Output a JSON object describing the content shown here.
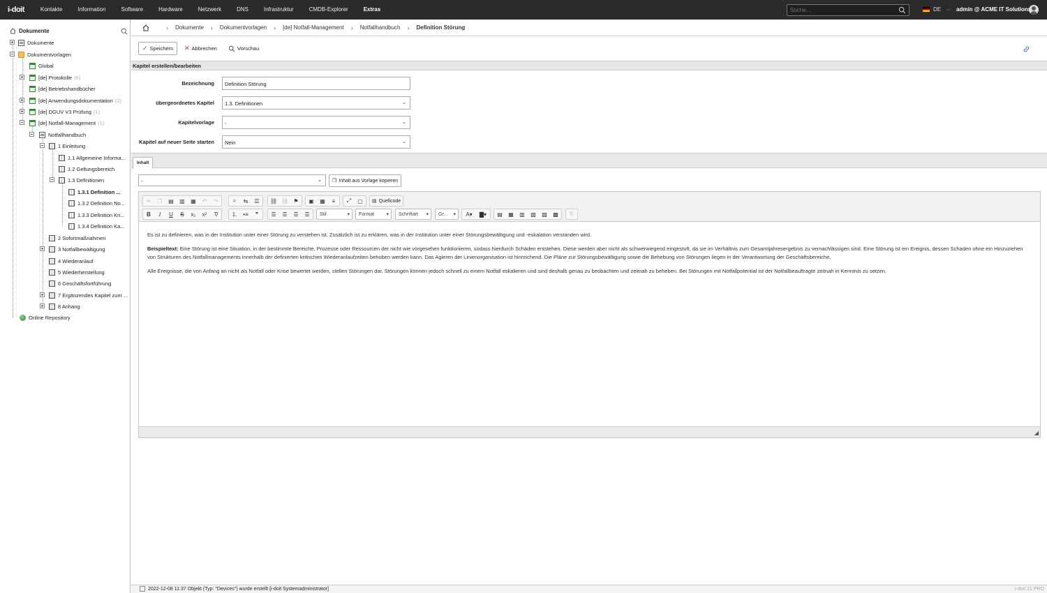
{
  "topbar": {
    "logo": "i-doit",
    "menu": [
      "Kontakte",
      "Information",
      "Software",
      "Hardware",
      "Netzwerk",
      "DNS",
      "Infrastruktur",
      "CMDB-Explorer",
      "Extras"
    ],
    "search_placeholder": "Suche...",
    "language": "DE",
    "user": "admin @ ACME IT Solutions"
  },
  "sidebar": {
    "title": "Dokumente",
    "tree": [
      {
        "label": "Dokumente",
        "icon": "document-icon"
      },
      {
        "label": "Dokumentvorlagen",
        "icon": "folder-icon"
      },
      {
        "label": "Global",
        "icon": "template-icon"
      },
      {
        "label": "[de] Protokolle",
        "count": "(6)",
        "icon": "template-icon"
      },
      {
        "label": "[de] Betriebshandbücher",
        "icon": "template-icon"
      },
      {
        "label": "[de] Anwendungsdokumentation",
        "count": "(2)",
        "icon": "template-icon"
      },
      {
        "label": "[de] DGUV V3 Prüfung",
        "count": "(1)",
        "icon": "template-icon"
      },
      {
        "label": "[de] Notfall-Management",
        "count": "(1)",
        "icon": "template-icon"
      },
      {
        "label": "Notfallhandbuch",
        "icon": "document-icon"
      },
      {
        "label": "1 Einleitung",
        "icon": "book-icon"
      },
      {
        "label": "1.1 Allgemeine Informa...",
        "icon": "book-icon"
      },
      {
        "label": "1.2 Geltungsbereich",
        "icon": "book-icon"
      },
      {
        "label": "1.3 Definitionen",
        "icon": "book-icon"
      },
      {
        "label": "1.3.1 Definition ...",
        "icon": "book-icon"
      },
      {
        "label": "1.3.2 Definition No...",
        "icon": "book-icon"
      },
      {
        "label": "1.3.3 Definition Kri...",
        "icon": "book-icon"
      },
      {
        "label": "1.3.4 Definition Ka...",
        "icon": "book-icon"
      },
      {
        "label": "2 Sofortmaßnahmen",
        "icon": "book-icon"
      },
      {
        "label": "3 Notfallbewältigung",
        "icon": "book-icon"
      },
      {
        "label": "4 Wiederanlauf",
        "icon": "book-icon"
      },
      {
        "label": "5 Wiederherstellung",
        "icon": "book-icon"
      },
      {
        "label": "6 Geschäftsfortführung",
        "icon": "book-icon"
      },
      {
        "label": "7 Ergänzendes Kapitel zum ...",
        "icon": "book-icon"
      },
      {
        "label": "8 Anhang",
        "icon": "book-icon"
      },
      {
        "label": "Online Repository",
        "icon": "globe-icon"
      }
    ]
  },
  "breadcrumb": [
    "Dokumente",
    "Dokumentvorlagen",
    "[de] Notfall-Management",
    "Notfallhandbuch",
    "Definition Störung"
  ],
  "toolbar": {
    "save": "Speichern",
    "cancel": "Abbrechen",
    "preview": "Vorschau"
  },
  "section_title": "Kapitel erstellen/bearbeiten",
  "form": {
    "name_label": "Bezeichnung",
    "name_value": "Definition Störung",
    "parent_label": "übergeordnetes Kapitel",
    "parent_value": "1.3. Definitionen",
    "template_label": "Kapitelvorlage",
    "template_value": "-",
    "newpage_label": "Kapitel auf neuer Seite starten",
    "newpage_value": "Nein"
  },
  "tab": "Inhalt",
  "content_template": {
    "value": "-",
    "copy_label": "Inhalt aus Vorlage kopieren"
  },
  "editor": {
    "source_label": "Quellcode",
    "combo_style": "Stil",
    "combo_format": "Format",
    "combo_font": "Schriftart",
    "combo_size": "Gr...",
    "para1": "Es ist zu definieren, was in der Institution unter einer Störung zu verstehen ist. Zusätzlich ist zu erklären, was in der Institution unter einer Störungsbewältigung und -eskalation verstanden wird.",
    "para2_bold": "Beispieltext:",
    "para2": " Eine Störung ist eine Situation, in der bestimmte Bereiche, Prozesse oder Ressourcen der nicht wie vorgesehen funktionieren, sodass hierdurch Schäden entstehen. Diese werden aber nicht als schwerwiegend eingestuft, da sie im Verhältnis zum Gesamtjahresergebnis zu vernachlässigen sind. Eine Störung ist ein Ereignis, dessen Schaden ohne ein Hinzuziehen von Strukturen des Notfallmanagements innerhalb der definierten kritischen Wiederanlaufzeiten behoben werden kann. Das Agieren der Linienorganisation ist hinreichend. Die Pläne zur Störungsbewältigung sowie die Behebung von Störungen liegen in der Verantwortung der Geschäftsbereiche.",
    "para3": "Alle Ereignisse, die von Anfang an nicht als Notfall oder Krise bewertet werden, stellen Störungen dar. Störungen können jedoch schnell zu einem Notfall eskalieren und sind deshalb genau zu beobachten und zeitnah zu beheben. Bei Störungen mit Notfallpotential ist der Notfallbeauftragte zeitnah in Kenntnis zu setzen."
  },
  "status": {
    "message": "2022-12-08 11:37 Objekt (Typ: \"Devices\") wurde erstellt [i-doit Systemadministrator]",
    "version": "i-doit 21 PRO"
  }
}
